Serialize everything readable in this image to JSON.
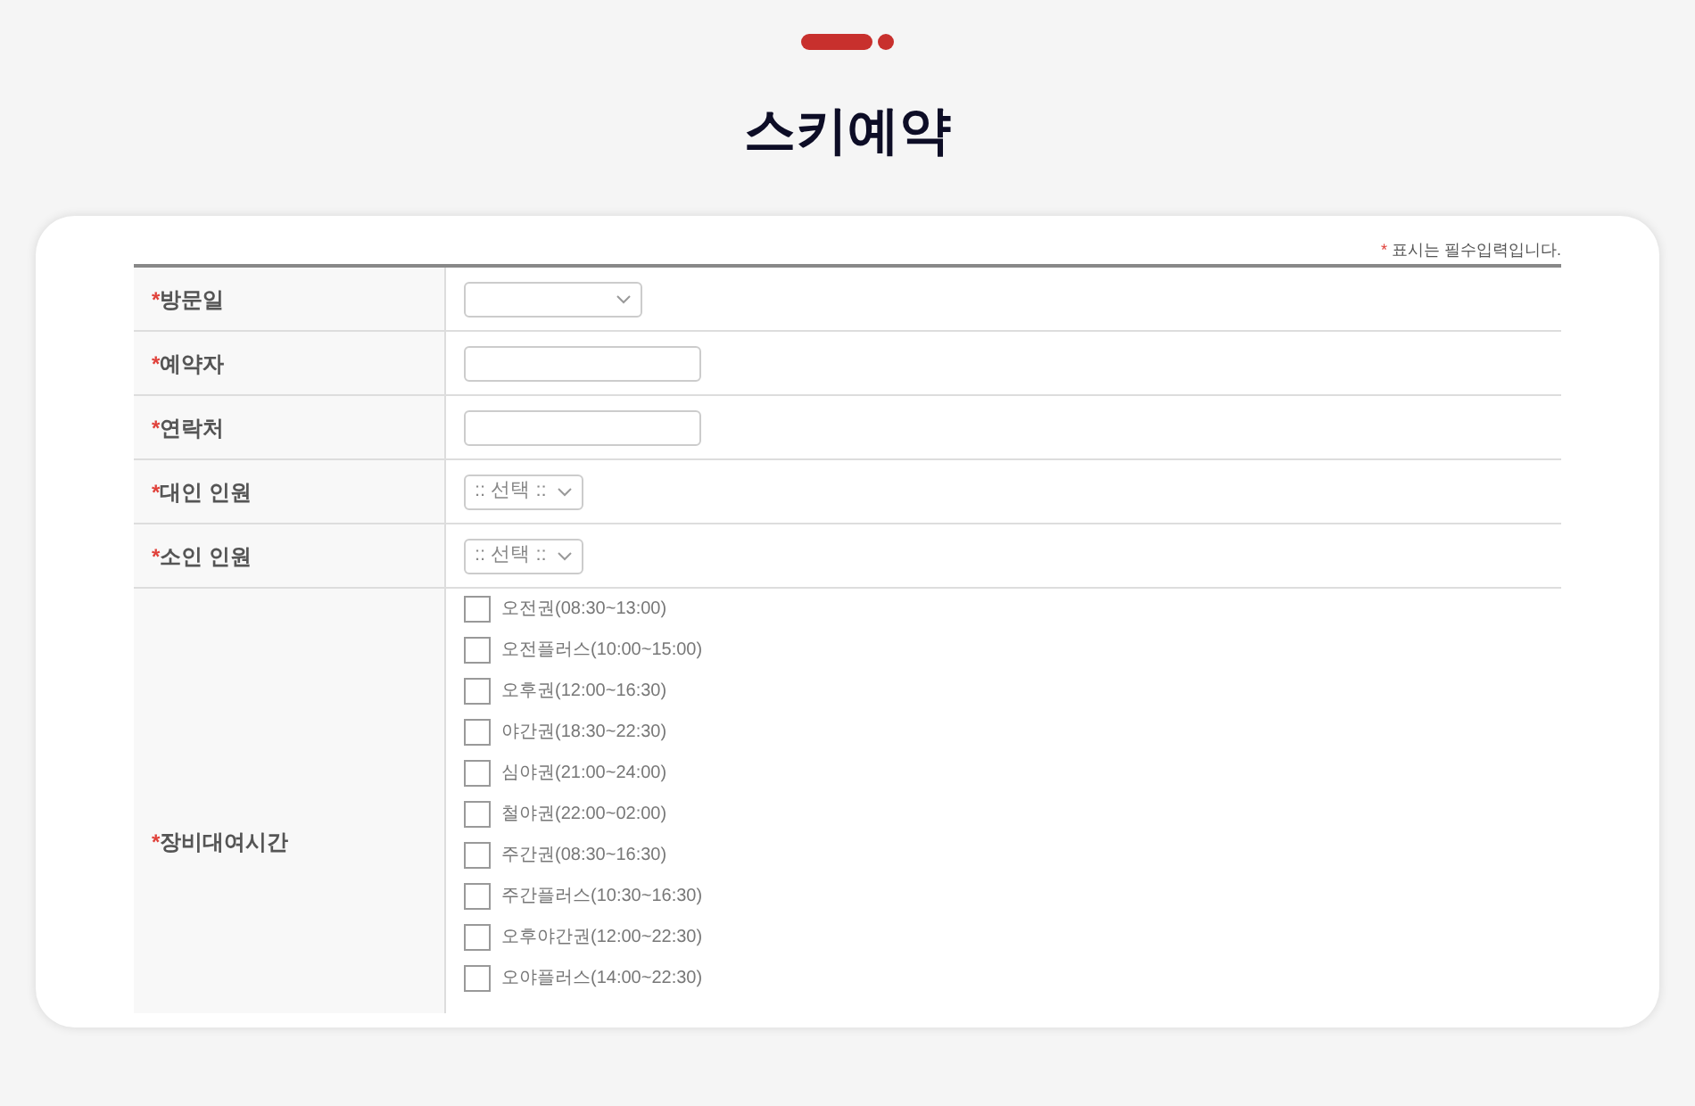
{
  "page_title": "스키예약",
  "required_note": {
    "mark": "*",
    "text": "표시는 필수입력입니다."
  },
  "form_rows": [
    {
      "kind": "select",
      "required": true,
      "label": "방문일",
      "value": ""
    },
    {
      "kind": "input",
      "required": true,
      "label": "예약자",
      "value": ""
    },
    {
      "kind": "input",
      "required": true,
      "label": "연락처",
      "value": ""
    },
    {
      "kind": "select",
      "required": true,
      "label": "대인 인원",
      "value": ":: 선택 ::"
    },
    {
      "kind": "select",
      "required": true,
      "label": "소인 인원",
      "value": ":: 선택 ::"
    },
    {
      "kind": "checkboxes",
      "required": true,
      "label": "장비대여시간",
      "options": [
        {
          "label": "오전권(08:30~13:00)",
          "checked": false
        },
        {
          "label": "오전플러스(10:00~15:00)",
          "checked": false
        },
        {
          "label": "오후권(12:00~16:30)",
          "checked": false
        },
        {
          "label": "야간권(18:30~22:30)",
          "checked": false
        },
        {
          "label": "심야권(21:00~24:00)",
          "checked": false
        },
        {
          "label": "철야권(22:00~02:00)",
          "checked": false
        },
        {
          "label": "주간권(08:30~16:30)",
          "checked": false
        },
        {
          "label": "주간플러스(10:30~16:30)",
          "checked": false
        },
        {
          "label": "오후야간권(12:00~22:30)",
          "checked": false
        },
        {
          "label": "오야플러스(14:00~22:30)",
          "checked": false
        }
      ]
    }
  ]
}
